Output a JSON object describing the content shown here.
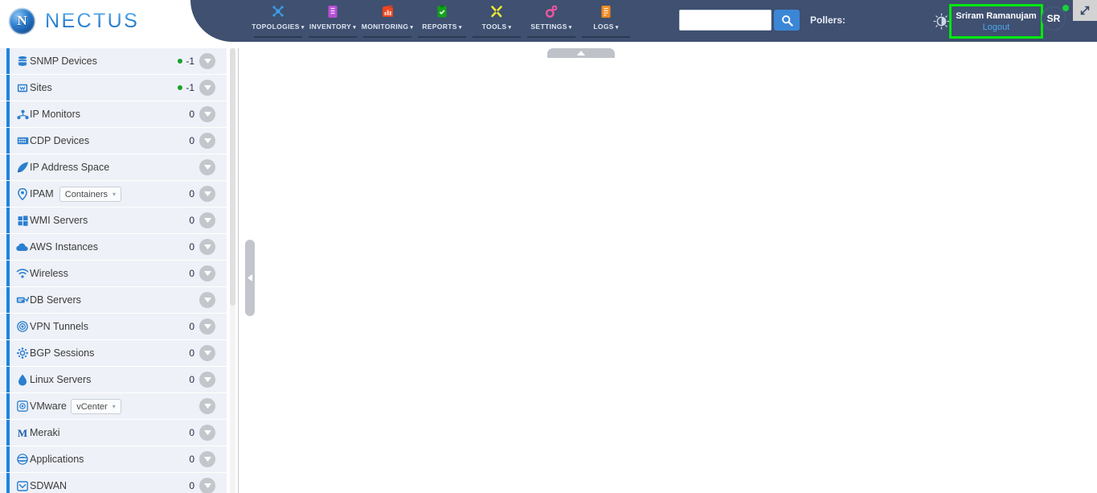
{
  "brand": {
    "name": "NECTUS",
    "mark": "N"
  },
  "topnav": {
    "items": [
      {
        "label": "TOPOLOGIES",
        "icon": "topologies-icon",
        "caret": "▾",
        "color": "#3aa0e8"
      },
      {
        "label": "INVENTORY",
        "icon": "inventory-icon",
        "caret": "▾",
        "color": "#b64fd6"
      },
      {
        "label": "MONITORING",
        "icon": "monitoring-icon",
        "caret": "▾",
        "color": "#f0441f"
      },
      {
        "label": "REPORTS",
        "icon": "reports-icon",
        "caret": "▾",
        "color": "#11a31b"
      },
      {
        "label": "TOOLS",
        "icon": "tools-icon",
        "caret": "▾",
        "color": "#ece935"
      },
      {
        "label": "SETTINGS",
        "icon": "settings-icon",
        "caret": "▾",
        "color": "#ef56a0"
      },
      {
        "label": "LOGS",
        "icon": "logs-icon",
        "caret": "▾",
        "color": "#ef8a1f"
      }
    ]
  },
  "search": {
    "value": "",
    "placeholder": "",
    "button_icon": "search-icon"
  },
  "pollers": {
    "label": "Pollers:",
    "value": ""
  },
  "user": {
    "name": "Sriram Ramanujam",
    "logout_label": "Logout",
    "initials": "SR",
    "status": "online",
    "highlight_color": "#00e908"
  },
  "theme_toggle": {
    "icon": "contrast-icon"
  },
  "expand": {
    "icon": "expand-arrows-icon"
  },
  "sidebar": {
    "items": [
      {
        "label": "SNMP Devices",
        "icon": "database-icon",
        "count": "-1",
        "dot": true,
        "chip": null
      },
      {
        "label": "Sites",
        "icon": "sites-icon",
        "count": "-1",
        "dot": true,
        "chip": null
      },
      {
        "label": "IP Monitors",
        "icon": "network-icon",
        "count": "0",
        "dot": false,
        "chip": null
      },
      {
        "label": "CDP Devices",
        "icon": "switch-icon",
        "count": "0",
        "dot": false,
        "chip": null
      },
      {
        "label": "IP Address Space",
        "icon": "rocket-icon",
        "count": "",
        "dot": false,
        "chip": null
      },
      {
        "label": "IPAM",
        "icon": "location-icon",
        "count": "0",
        "dot": false,
        "chip": "Containers"
      },
      {
        "label": "WMI Servers",
        "icon": "windows-icon",
        "count": "0",
        "dot": false,
        "chip": null
      },
      {
        "label": "AWS Instances",
        "icon": "cloud-icon",
        "count": "0",
        "dot": false,
        "chip": null
      },
      {
        "label": "Wireless",
        "icon": "wifi-icon",
        "count": "0",
        "dot": false,
        "chip": null
      },
      {
        "label": "DB Servers",
        "icon": "db-server-icon",
        "count": "",
        "dot": false,
        "chip": null
      },
      {
        "label": "VPN Tunnels",
        "icon": "vpn-icon",
        "count": "0",
        "dot": false,
        "chip": null
      },
      {
        "label": "BGP Sessions",
        "icon": "bgp-icon",
        "count": "0",
        "dot": false,
        "chip": null
      },
      {
        "label": "Linux Servers",
        "icon": "linux-icon",
        "count": "0",
        "dot": false,
        "chip": null
      },
      {
        "label": "VMware",
        "icon": "vmware-icon",
        "count": "",
        "dot": false,
        "chip": "vCenter"
      },
      {
        "label": "Meraki",
        "icon": "meraki-icon",
        "count": "0",
        "dot": false,
        "chip": null
      },
      {
        "label": "Applications",
        "icon": "applications-icon",
        "count": "0",
        "dot": false,
        "chip": null
      },
      {
        "label": "SDWAN",
        "icon": "sdwan-icon",
        "count": "0",
        "dot": false,
        "chip": null
      }
    ],
    "chip_caret": "▾",
    "expand_caret": "▾"
  },
  "main": {
    "collapse_handle_icon": "chevron-left-icon",
    "top_tab_icon": "chevron-up-icon",
    "content": ""
  }
}
